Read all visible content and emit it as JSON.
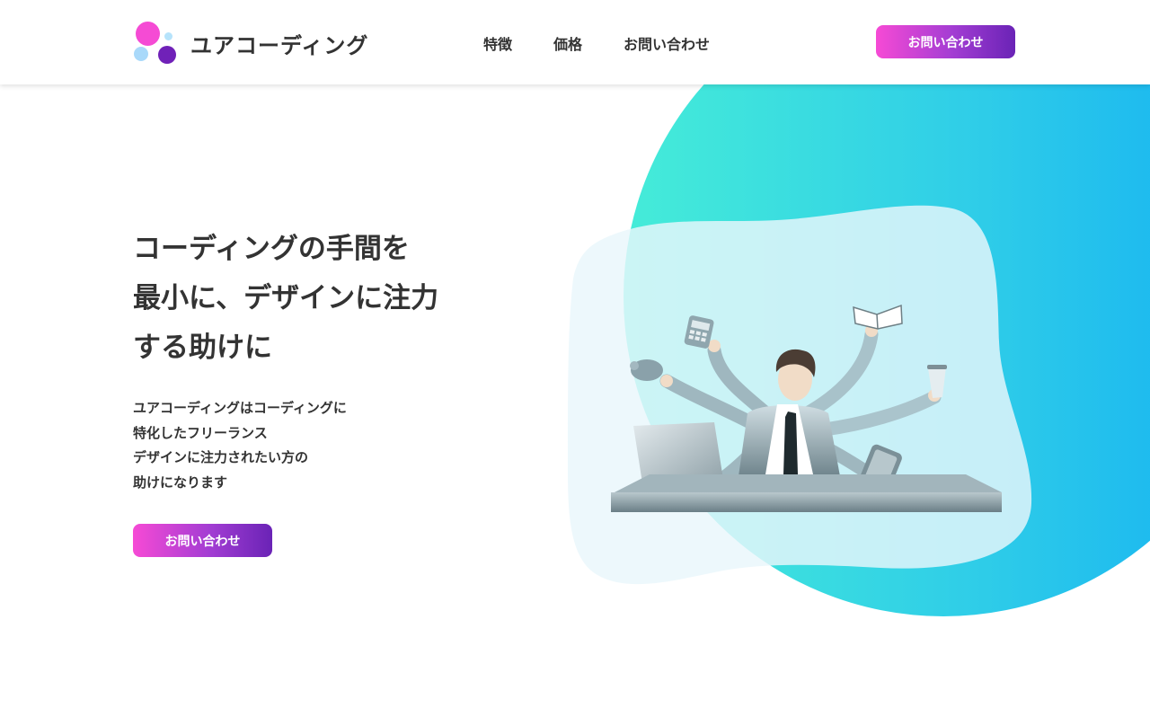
{
  "header": {
    "logo_text": "ユアコーディング",
    "nav": [
      {
        "label": "特徴"
      },
      {
        "label": "価格"
      },
      {
        "label": "お問い合わせ"
      }
    ],
    "cta_label": "お問い合わせ"
  },
  "hero": {
    "title_lines": [
      "コーディングの手間を",
      "最小に、デザインに注力",
      "する助けに"
    ],
    "lead_lines": [
      "ユアコーディングはコーディングに",
      "特化したフリーランス",
      "デザインに注力されたい方の",
      "助けになります"
    ],
    "cta_label": "お問い合わせ"
  },
  "colors": {
    "accent_pink": "#f64ad5",
    "accent_purple": "#6a23b6",
    "blob_teal": "#45ecd8",
    "blob_blue": "#18b3f2",
    "text": "#333333"
  }
}
